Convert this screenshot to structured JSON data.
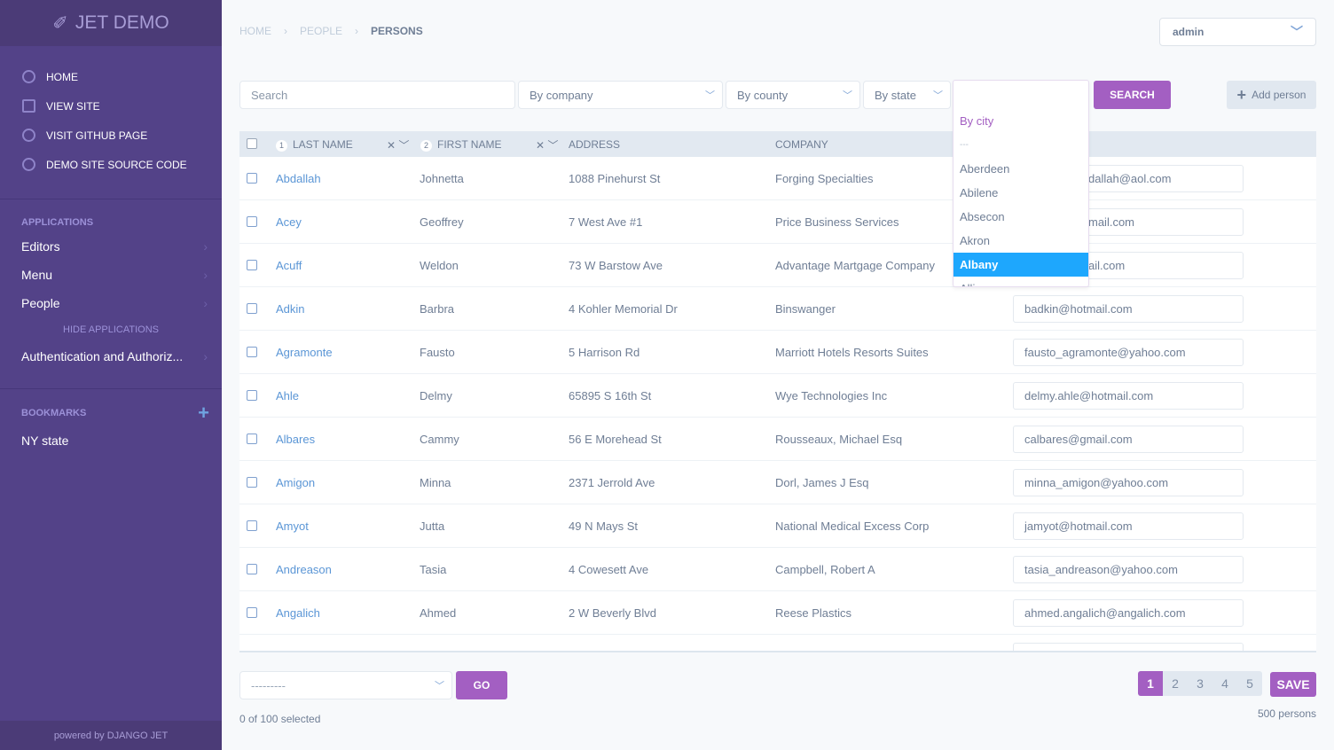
{
  "sidebar": {
    "logo": "JET DEMO",
    "quick_links": [
      "HOME",
      "VIEW SITE",
      "VISIT GITHUB PAGE",
      "DEMO SITE SOURCE CODE"
    ],
    "applications_label": "APPLICATIONS",
    "apps": [
      "Editors",
      "Menu",
      "People"
    ],
    "hide_apps": "HIDE APPLICATIONS",
    "apps2": [
      "Authentication and Authoriz..."
    ],
    "bookmarks_label": "BOOKMARKS",
    "bookmarks": [
      "NY state"
    ],
    "powered": "powered by DJANGO JET"
  },
  "breadcrumb": [
    "HOME",
    "PEOPLE",
    "PERSONS"
  ],
  "user": "admin",
  "filters": {
    "search_placeholder": "Search",
    "company": "By company",
    "county": "By county",
    "state": "By state",
    "search_button": "SEARCH",
    "add_person": "Add person"
  },
  "city_dropdown": {
    "title": "By city",
    "options": [
      "---",
      "Aberdeen",
      "Abilene",
      "Absecon",
      "Akron",
      "Albany",
      "Alliance"
    ],
    "selected": "Albany"
  },
  "table": {
    "headers": [
      "LAST NAME",
      "FIRST NAME",
      "ADDRESS",
      "COMPANY"
    ],
    "sort_orders": [
      "1",
      "2"
    ],
    "rows": [
      [
        "Abdallah",
        "Johnetta",
        "1088 Pinehurst St",
        "Forging Specialties",
        "dallah@aol.com"
      ],
      [
        "Acey",
        "Geoffrey",
        "7 West Ave #1",
        "Price Business Services",
        "mail.com"
      ],
      [
        "Acuff",
        "Weldon",
        "73 W Barstow Ave",
        "Advantage Martgage Company",
        "ail.com"
      ],
      [
        "Adkin",
        "Barbra",
        "4 Kohler Memorial Dr",
        "Binswanger",
        "badkin@hotmail.com"
      ],
      [
        "Agramonte",
        "Fausto",
        "5 Harrison Rd",
        "Marriott Hotels Resorts Suites",
        "fausto_agramonte@yahoo.com"
      ],
      [
        "Ahle",
        "Delmy",
        "65895 S 16th St",
        "Wye Technologies Inc",
        "delmy.ahle@hotmail.com"
      ],
      [
        "Albares",
        "Cammy",
        "56 E Morehead St",
        "Rousseaux, Michael Esq",
        "calbares@gmail.com"
      ],
      [
        "Amigon",
        "Minna",
        "2371 Jerrold Ave",
        "Dorl, James J Esq",
        "minna_amigon@yahoo.com"
      ],
      [
        "Amyot",
        "Jutta",
        "49 N Mays St",
        "National Medical Excess Corp",
        "jamyot@hotmail.com"
      ],
      [
        "Andreason",
        "Tasia",
        "4 Cowesett Ave",
        "Campbell, Robert A",
        "tasia_andreason@yahoo.com"
      ],
      [
        "Angalich",
        "Ahmed",
        "2 W Beverly Blvd",
        "Reese Plastics",
        "ahmed.angalich@angalich.com"
      ]
    ]
  },
  "footer": {
    "action": "---------",
    "go": "GO",
    "selected": "0 of 100 selected",
    "pages": [
      "1",
      "2",
      "3",
      "4",
      "5"
    ],
    "current_page": "1",
    "save": "SAVE",
    "count": "500 persons"
  },
  "colors": {
    "sidebar": "#534288",
    "accent": "#a35fc2",
    "selected_option": "#1ea7fd",
    "link": "#5b96d6"
  }
}
